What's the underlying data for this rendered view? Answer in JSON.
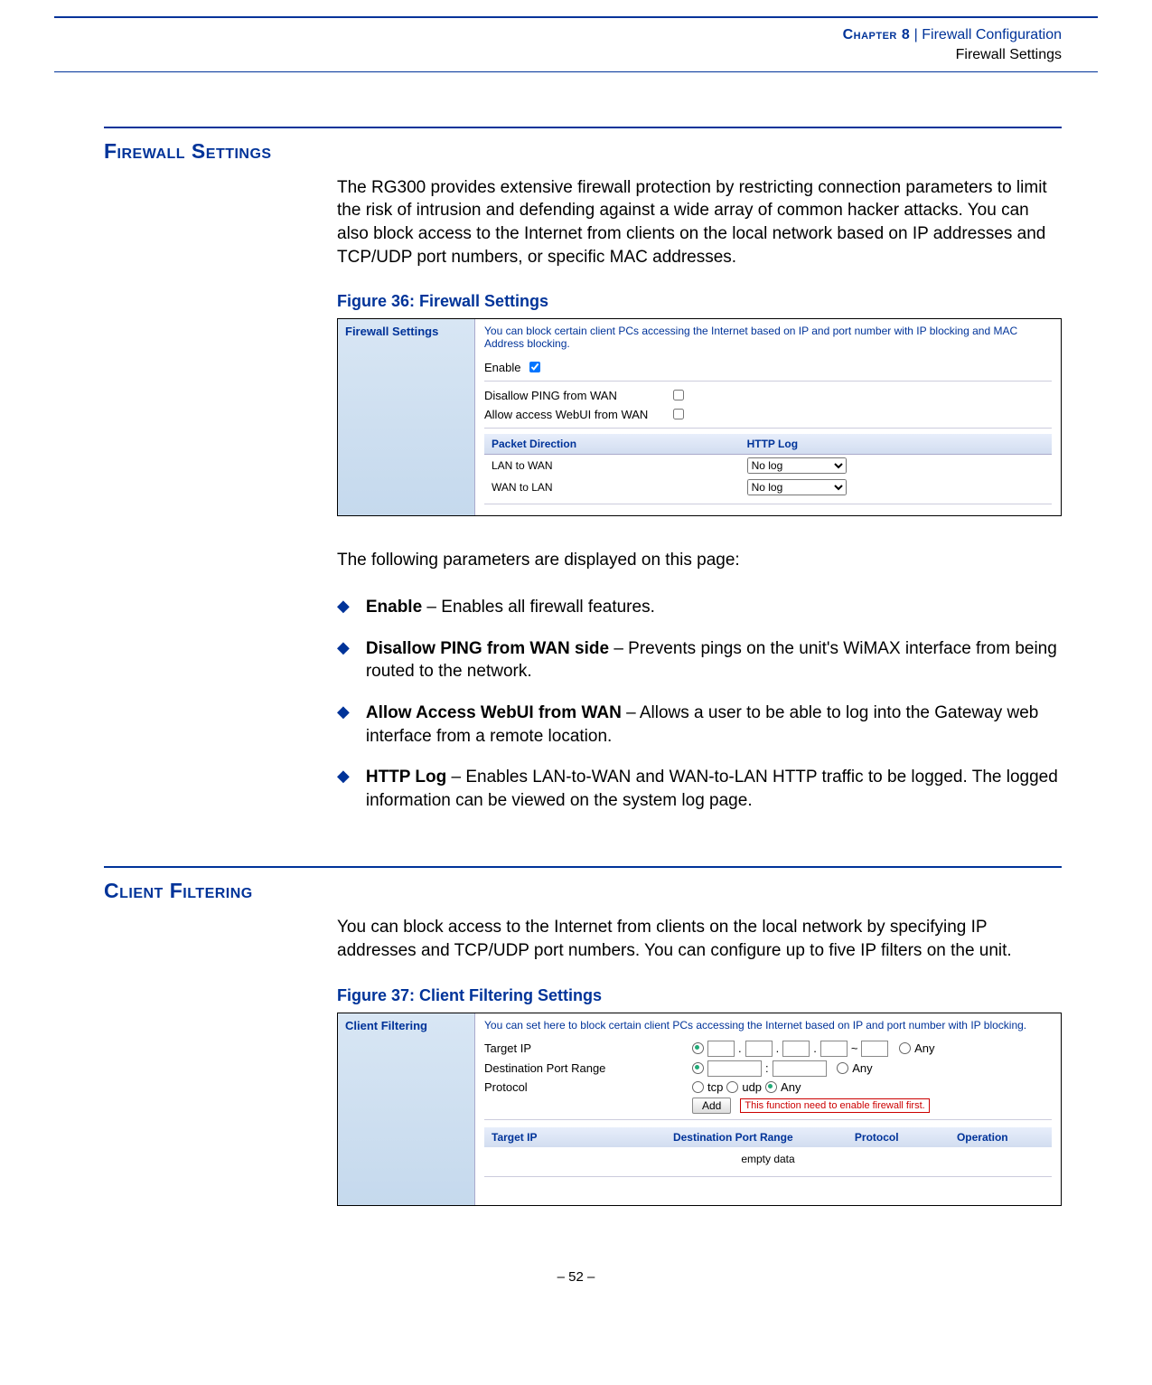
{
  "header": {
    "chapter": "Chapter 8",
    "separator": "  |  ",
    "title": "Firewall Configuration",
    "subtitle": "Firewall Settings"
  },
  "section1": {
    "title": "Firewall Settings",
    "intro": "The RG300 provides extensive firewall protection by restricting connection parameters to limit the risk of intrusion and defending against a wide array of common hacker attacks. You can also block access to the Internet from clients on the local network based on IP addresses and TCP/UDP port numbers, or specific MAC addresses.",
    "figure_caption": "Figure 36:  Firewall Settings",
    "screenshot": {
      "side_label": "Firewall Settings",
      "description": "You can block certain client PCs accessing the Internet based on IP and port number with IP blocking and MAC Address blocking.",
      "enable_label": "Enable",
      "disallow_ping_label": "Disallow PING from WAN",
      "allow_webui_label": "Allow access WebUI from WAN",
      "table_headers": {
        "col1": "Packet Direction",
        "col2": "HTTP Log"
      },
      "rows": [
        {
          "dir": "LAN to WAN",
          "log": "No log"
        },
        {
          "dir": "WAN to LAN",
          "log": "No log"
        }
      ]
    },
    "following_text": "The following parameters are displayed on this page:",
    "bullets": [
      {
        "term": "Enable",
        "desc": " – Enables all firewall features."
      },
      {
        "term": "Disallow PING from WAN side",
        "desc": " – Prevents pings on the unit's WiMAX interface from being routed to the network."
      },
      {
        "term": "Allow Access WebUI from WAN",
        "desc": " – Allows a user to be able to log into the Gateway web interface from a remote location."
      },
      {
        "term": "HTTP Log",
        "desc": " – Enables LAN-to-WAN and WAN-to-LAN HTTP traffic to be logged. The logged information can be viewed on the system log page."
      }
    ]
  },
  "section2": {
    "title": "Client Filtering",
    "intro": "You can block access to the Internet from clients on the local network by specifying IP addresses and TCP/UDP port numbers. You can configure up to five IP filters on the unit.",
    "figure_caption": "Figure 37:  Client Filtering Settings",
    "screenshot": {
      "side_label": "Client Filtering",
      "description": "You can set here to block certain client PCs accessing the Internet based on IP and port number with IP blocking.",
      "target_ip_label": "Target IP",
      "dest_port_label": "Destination Port Range",
      "protocol_label": "Protocol",
      "any_label": "Any",
      "tcp_label": "tcp",
      "udp_label": "udp",
      "add_button": "Add",
      "warning": "This function need to enable firewall first.",
      "table_headers": {
        "c1": "Target IP",
        "c2": "Destination Port Range",
        "c3": "Protocol",
        "c4": "Operation"
      },
      "empty_text": "empty data"
    }
  },
  "footer": {
    "page": "–  52  –"
  }
}
